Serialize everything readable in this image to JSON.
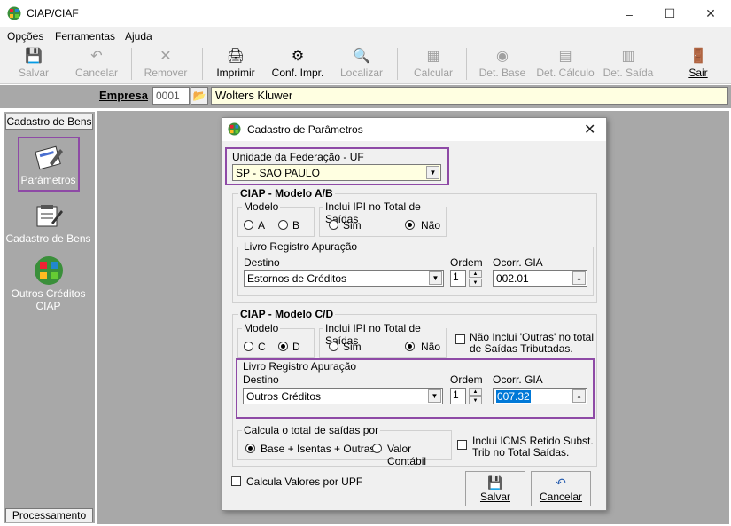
{
  "window": {
    "title": "CIAP/CIAF",
    "controls": [
      "–",
      "☐",
      "✕"
    ]
  },
  "menu": [
    "Opções",
    "Ferramentas",
    "Ajuda"
  ],
  "toolbar": [
    {
      "label": "Salvar",
      "icon": "save-icon",
      "enabled": false
    },
    {
      "label": "Cancelar",
      "icon": "undo-icon",
      "enabled": false
    },
    {
      "label": "Remover",
      "icon": "remove-icon",
      "enabled": false
    },
    {
      "label": "Imprimir",
      "icon": "printer-icon",
      "enabled": true
    },
    {
      "label": "Conf. Impr.",
      "icon": "printer-config-icon",
      "enabled": true
    },
    {
      "label": "Localizar",
      "icon": "search-icon",
      "enabled": false
    },
    {
      "label": "Calcular",
      "icon": "calculate-icon",
      "enabled": false
    },
    {
      "label": "Det. Base",
      "icon": "detail-base-icon",
      "enabled": false
    },
    {
      "label": "Det. Cálculo",
      "icon": "detail-calc-icon",
      "enabled": false
    },
    {
      "label": "Det. Saída",
      "icon": "detail-output-icon",
      "enabled": false
    },
    {
      "label": "Sair",
      "icon": "exit-door-icon",
      "enabled": true
    }
  ],
  "company": {
    "label": "Empresa",
    "code": "0001",
    "name": "Wolters Kluwer"
  },
  "sidebar": {
    "header": "Cadastro de Bens",
    "items": [
      {
        "label": "Parâmetros",
        "icon": "parameters-icon"
      },
      {
        "label": "Cadastro de Bens",
        "icon": "asset-register-icon"
      },
      {
        "label": "Outros Créditos CIAP",
        "icon": "other-credits-icon"
      }
    ],
    "footer": "Processamento"
  },
  "dialog": {
    "title": "Cadastro de Parâmetros",
    "uf": {
      "label": "Unidade da Federação - UF",
      "value": "SP - SAO PAULO"
    },
    "ab": {
      "title": "CIAP - Modelo A/B",
      "modelo": {
        "label": "Modelo",
        "options": [
          "A",
          "B"
        ],
        "selected": null
      },
      "ipi": {
        "label": "Inclui IPI no Total de Saídas",
        "options": [
          "Sim",
          "Não"
        ],
        "selected": "Não"
      },
      "livro": {
        "label": "Livro Registro Apuração",
        "destino_label": "Destino",
        "destino": "Estornos de Créditos",
        "ordem_label": "Ordem",
        "ordem": "1",
        "gia_label": "Ocorr. GIA",
        "gia": "002.01"
      }
    },
    "cd": {
      "title": "CIAP - Modelo C/D",
      "modelo": {
        "label": "Modelo",
        "options": [
          "C",
          "D"
        ],
        "selected": "D"
      },
      "ipi": {
        "label": "Inclui IPI no Total de Saídas",
        "options": [
          "Sim",
          "Não"
        ],
        "selected": "Não"
      },
      "outras_line1": "Não Inclui 'Outras' no total",
      "outras_line2": "de Saídas  Tributadas.",
      "livro": {
        "label": "Livro Registro Apuração",
        "destino_label": "Destino",
        "destino": "Outros Créditos",
        "ordem_label": "Ordem",
        "ordem": "1",
        "gia_label": "Ocorr. GIA",
        "gia": "007.32"
      },
      "calcula": {
        "label": "Calcula o total de saídas por",
        "options": [
          "Base + Isentas + Outras",
          "Valor Contábil"
        ],
        "selected": "Base + Isentas + Outras"
      },
      "icms_line1": "Inclui ICMS Retido Subst.",
      "icms_line2": "Trib no Total Saídas."
    },
    "upf": "Calcula Valores por UPF",
    "buttons": {
      "save": "Salvar",
      "cancel": "Cancelar"
    }
  },
  "colors": {
    "highlight": "#8e4aa6",
    "selection": "#0078d7",
    "input_yellow": "#ffffe1"
  }
}
